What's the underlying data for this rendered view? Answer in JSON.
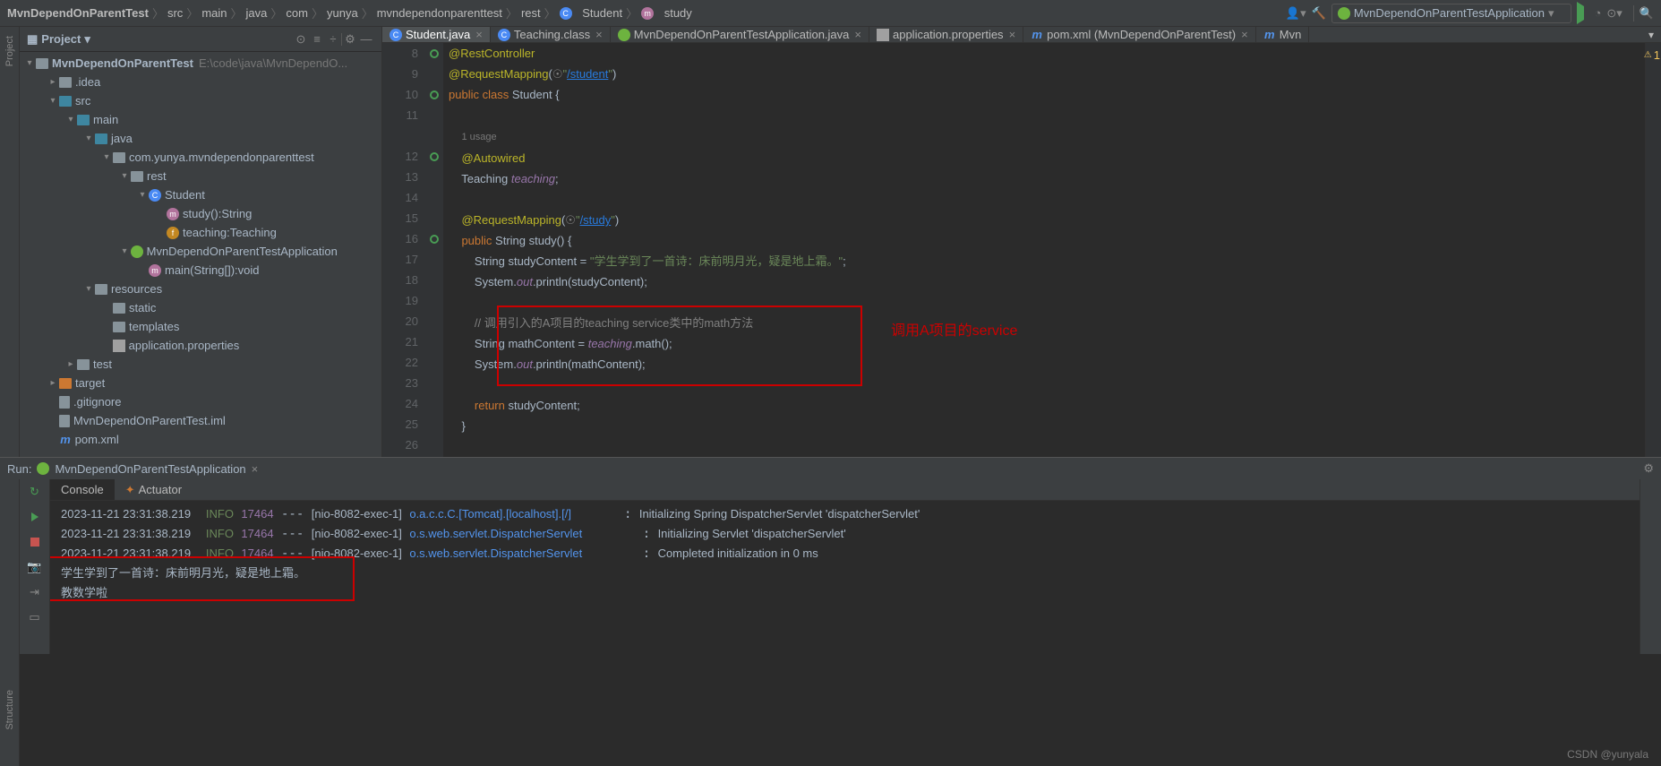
{
  "breadcrumb": [
    "MvnDependOnParentTest",
    "src",
    "main",
    "java",
    "com",
    "yunya",
    "mvndependonparenttest",
    "rest",
    "Student",
    "study"
  ],
  "run_config": "MvnDependOnParentTestApplication",
  "warnings_count": "1",
  "project_panel": {
    "title": "Project"
  },
  "tree": {
    "root": "MvnDependOnParentTest",
    "root_path": "E:\\code\\java\\MvnDependO...",
    "idea": ".idea",
    "src": "src",
    "main": "main",
    "java": "java",
    "pkg": "com.yunya.mvndependonparenttest",
    "rest": "rest",
    "student": "Student",
    "study": "study():String",
    "teaching": "teaching:Teaching",
    "app": "MvnDependOnParentTestApplication",
    "main_method": "main(String[]):void",
    "resources": "resources",
    "static": "static",
    "templates": "templates",
    "app_props": "application.properties",
    "test": "test",
    "target": "target",
    "gitignore": ".gitignore",
    "iml": "MvnDependOnParentTest.iml",
    "pom": "pom.xml"
  },
  "tabs": [
    {
      "label": "Student.java",
      "icon": "c",
      "active": true
    },
    {
      "label": "Teaching.class",
      "icon": "c"
    },
    {
      "label": "MvnDependOnParentTestApplication.java",
      "icon": "sp"
    },
    {
      "label": "application.properties",
      "icon": "prop"
    },
    {
      "label": "pom.xml (MvnDependOnParentTest)",
      "icon": "mvn"
    },
    {
      "label": "Mvn",
      "icon": "mvn",
      "overflow": true
    }
  ],
  "code": {
    "usage": "1 usage",
    "lines": {
      "8": {
        "t": "@RestController",
        "cls": "ann"
      },
      "9": {
        "pre": "@RequestMapping(",
        "link": "\"/student\"",
        "post": ")"
      },
      "10": {
        "t": "public class Student {"
      },
      "11": {
        "t": ""
      },
      "12a": {
        "t": "    "
      },
      "12": {
        "t": "    @Autowired",
        "cls": "ann"
      },
      "13": {
        "t": "    Teaching teaching;"
      },
      "14": {
        "t": ""
      },
      "15": {
        "pre": "    @RequestMapping(",
        "link": "\"/study\"",
        "post": ")"
      },
      "16": {
        "t": "    public String study() {"
      },
      "17": {
        "t": "        String studyContent = \"学生学到了一首诗：床前明月光，疑是地上霜。\";"
      },
      "18": {
        "t": "        System.out.println(studyContent);"
      },
      "19": {
        "t": ""
      },
      "20": {
        "t": "        // 调用引入的A项目的teaching service类中的math方法",
        "cls": "com"
      },
      "21": {
        "t": "        String mathContent = teaching.math();"
      },
      "22": {
        "t": "        System.out.println(mathContent);"
      },
      "23": {
        "t": ""
      },
      "24": {
        "t": "        return studyContent;"
      },
      "25": {
        "t": "    }"
      },
      "26": {
        "t": ""
      }
    }
  },
  "annotation": "调用A项目的service",
  "run": {
    "label": "Run:",
    "title": "MvnDependOnParentTestApplication",
    "tabs": [
      "Console",
      "Actuator"
    ],
    "logs": [
      {
        "ts": "2023-11-21 23:31:38.219",
        "lvl": "INFO",
        "pid": "17464",
        "thr": "[nio-8082-exec-1]",
        "cls": "o.a.c.c.C.[Tomcat].[localhost].[/]",
        "msg": "Initializing Spring DispatcherServlet 'dispatcherServlet'"
      },
      {
        "ts": "2023-11-21 23:31:38.219",
        "lvl": "INFO",
        "pid": "17464",
        "thr": "[nio-8082-exec-1]",
        "cls": "o.s.web.servlet.DispatcherServlet",
        "msg": "Initializing Servlet 'dispatcherServlet'"
      },
      {
        "ts": "2023-11-21 23:31:38.219",
        "lvl": "INFO",
        "pid": "17464",
        "thr": "[nio-8082-exec-1]",
        "cls": "o.s.web.servlet.DispatcherServlet",
        "msg": "Completed initialization in 0 ms"
      }
    ],
    "out": [
      "学生学到了一首诗：床前明月光，疑是地上霜。",
      "教数学啦"
    ]
  },
  "watermark": "CSDN @yunyala"
}
